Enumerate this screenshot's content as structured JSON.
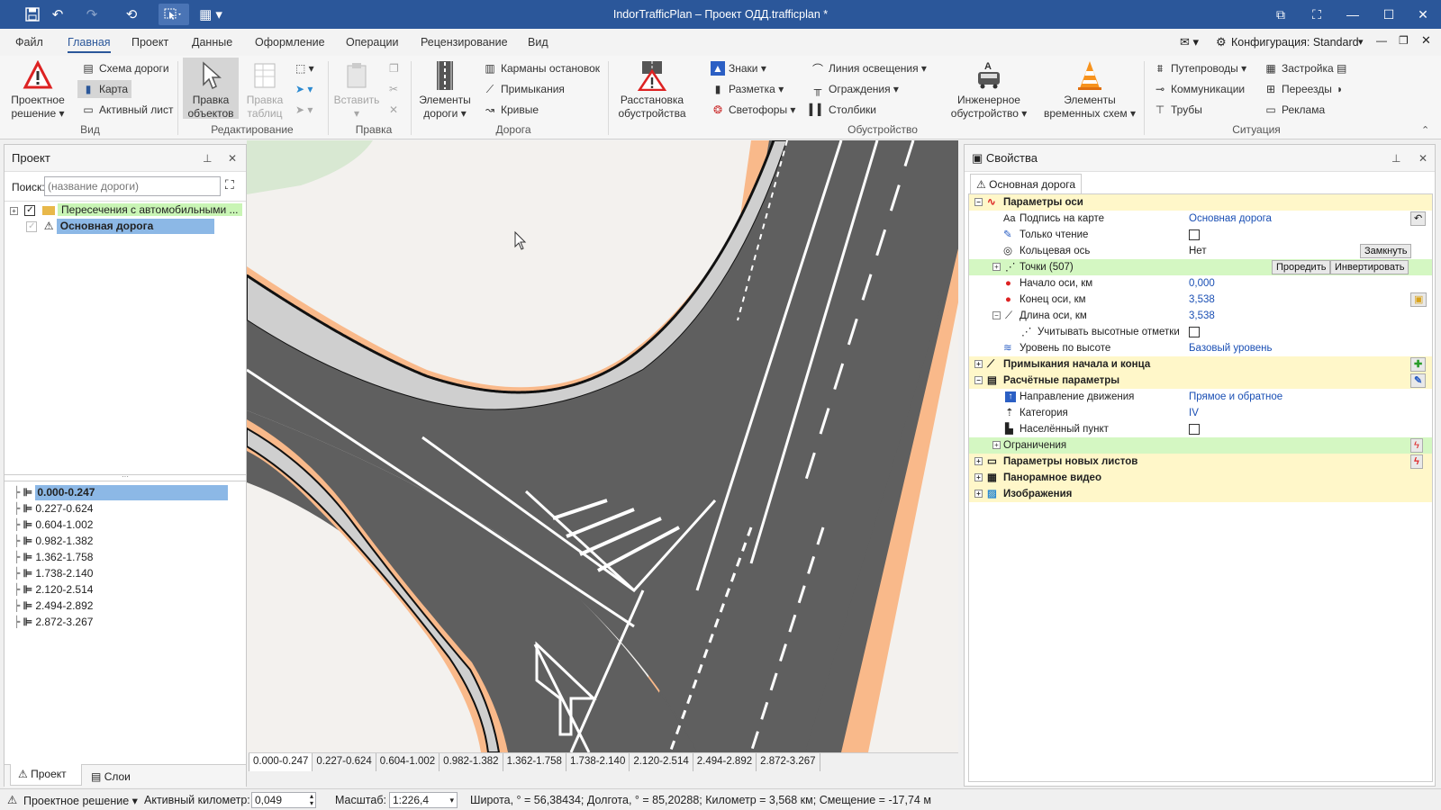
{
  "app": {
    "title": "IndorTrafficPlan – Проект ОДД.trafficplan *"
  },
  "menu": {
    "tabs": [
      "Файл",
      "Главная",
      "Проект",
      "Данные",
      "Оформление",
      "Операции",
      "Рецензирование",
      "Вид"
    ],
    "active_tab": "Главная",
    "configuration": "Конфигурация: Standard"
  },
  "ribbon": {
    "vid": {
      "project_solution": "Проектное решение",
      "road_scheme": "Схема дороги",
      "map": "Карта",
      "active_sheet": "Активный лист",
      "group_label": "Вид"
    },
    "editing": {
      "edit_objects": "Правка объектов",
      "edit_tables": "Правка таблиц",
      "group_label": "Редактирование"
    },
    "pravka": {
      "paste": "Вставить",
      "group_label": "Правка"
    },
    "road": {
      "road_elements": "Элементы дороги",
      "bus_stops": "Карманы остановок",
      "junctions": "Примыкания",
      "curves": "Кривые",
      "group_label": "Дорога"
    },
    "equipment": {
      "placement": "Расстановка обустройства",
      "signs": "Знаки",
      "marking": "Разметка",
      "traffic_lights": "Светофоры",
      "lighting_line": "Линия освещения",
      "fences": "Ограждения",
      "posts": "Столбики",
      "engineering": "Инженерное обустройство",
      "temp_schemes": "Элементы временных схем",
      "group_label": "Обустройство"
    },
    "situation": {
      "overpasses": "Путепроводы",
      "utilities": "Коммуникации",
      "pipes": "Трубы",
      "buildings": "Застройка",
      "crossings": "Переезды",
      "advertising": "Реклама",
      "group_label": "Ситуация"
    }
  },
  "project_panel": {
    "title": "Проект",
    "search_label": "Поиск:",
    "search_placeholder": "(название дороги)",
    "tree": [
      {
        "label": "Пересечения с автомобильными ..."
      },
      {
        "label": "Основная дорога"
      }
    ],
    "sections": [
      "0.000-0.247",
      "0.227-0.624",
      "0.604-1.002",
      "0.982-1.382",
      "1.362-1.758",
      "1.738-2.140",
      "2.120-2.514",
      "2.494-2.892",
      "2.872-3.267"
    ],
    "bottom_tabs": [
      "Проект",
      "Слои"
    ]
  },
  "map": {
    "sheet_tabs": [
      "0.000-0.247",
      "0.227-0.624",
      "0.604-1.002",
      "0.982-1.382",
      "1.362-1.758",
      "1.738-2.140",
      "2.120-2.514",
      "2.494-2.892",
      "2.872-3.267"
    ]
  },
  "properties": {
    "title": "Свойства",
    "object_tab": "Основная дорога",
    "rows": {
      "axis_params": "Параметры оси",
      "map_caption_label": "Подпись на карте",
      "map_caption_value": "Основная дорога",
      "readonly_label": "Только чтение",
      "ring_label": "Кольцевая ось",
      "ring_value": "Нет",
      "ring_btn": "Замкнуть",
      "points_label": "Точки (507)",
      "points_btn1": "Проредить",
      "points_btn2": "Инвертировать",
      "start_label": "Начало оси, км",
      "start_value": "0,000",
      "end_label": "Конец оси, км",
      "end_value": "3,538",
      "length_label": "Длина оси, км",
      "length_value": "3,538",
      "elev_label": "Учитывать высотные отметки",
      "level_label": "Уровень по высоте",
      "level_value": "Базовый уровень",
      "junctions_group": "Примыкания начала и конца",
      "calc_group": "Расчётные параметры",
      "direction_label": "Направление движения",
      "direction_value": "Прямое и обратное",
      "category_label": "Категория",
      "category_value": "IV",
      "settlement_label": "Населённый пункт",
      "limits_label": "Ограничения",
      "new_sheets_group": "Параметры новых листов",
      "panorama_group": "Панорамное видео",
      "images_group": "Изображения"
    }
  },
  "status": {
    "mode": "Проектное решение",
    "active_km_label": "Активный километр:",
    "active_km_value": "0,049",
    "scale_label": "Масштаб:",
    "scale_value": "1:226,4",
    "coords": "Широта, ° = 56,38434; Долгота, ° = 85,20288; Километр = 3,568 км; Смещение = -17,74 м"
  },
  "colors": {
    "titlebar": "#2b579a",
    "accent": "#2b579a",
    "asphalt": "#5f5f5f",
    "shoulder": "#f9b98a",
    "group_row": "#fff7c9",
    "green_row": "#d4f7c2",
    "selected": "#8cb8e6"
  },
  "icons": [
    "save-icon",
    "undo-icon",
    "redo-icon",
    "refresh-icon",
    "pin-icon",
    "close-icon",
    "search-binoculars-icon",
    "folder-icon",
    "warning-sign-icon",
    "section-icon",
    "plus-icon",
    "pencil-icon",
    "flash-icon",
    "lock-icon"
  ]
}
